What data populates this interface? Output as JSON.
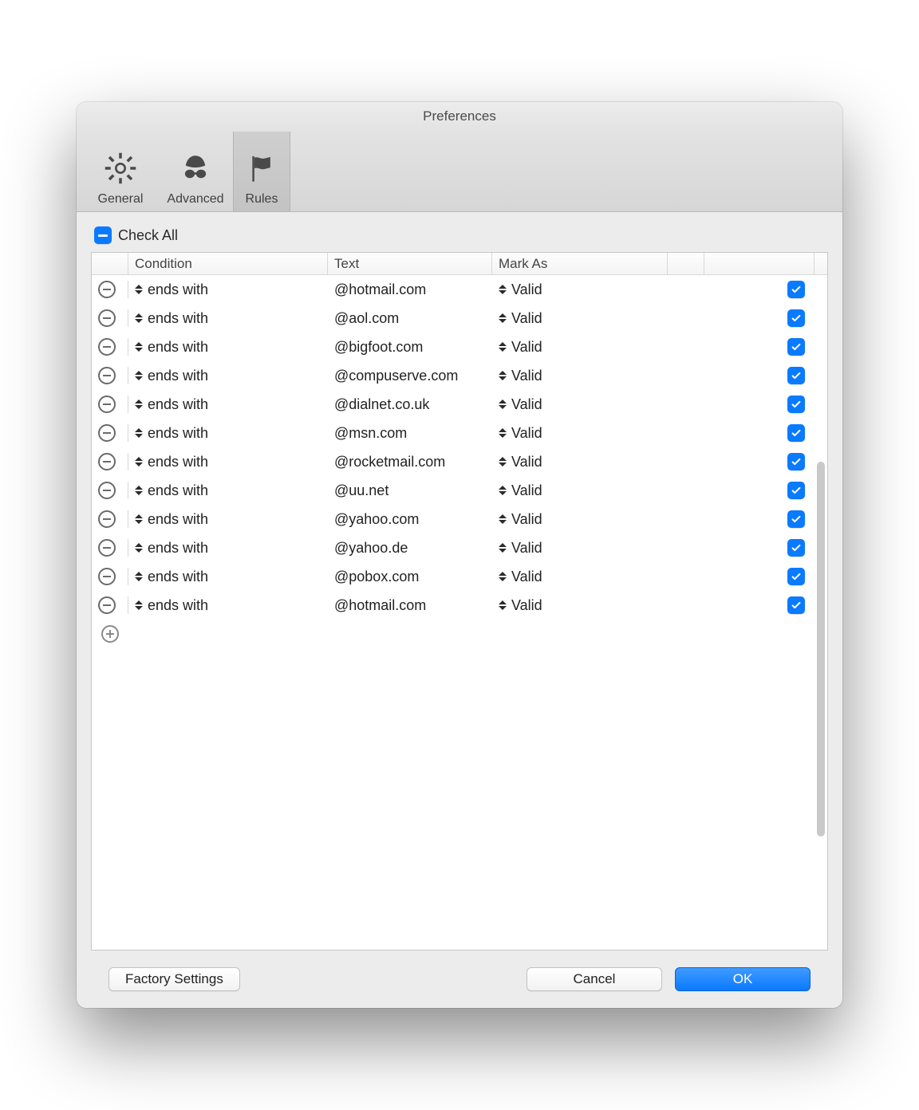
{
  "window": {
    "title": "Preferences"
  },
  "toolbar": {
    "general": {
      "label": "General"
    },
    "advanced": {
      "label": "Advanced"
    },
    "rules": {
      "label": "Rules"
    },
    "selected": "rules"
  },
  "checkAll": {
    "label": "Check All",
    "state": "indeterminate"
  },
  "columns": {
    "condition": "Condition",
    "text": "Text",
    "mark": "Mark As"
  },
  "rows": [
    {
      "condition": "ends with",
      "text": "@hotmail.com",
      "mark": "Valid",
      "checked": true
    },
    {
      "condition": "ends with",
      "text": "@aol.com",
      "mark": "Valid",
      "checked": true
    },
    {
      "condition": "ends with",
      "text": "@bigfoot.com",
      "mark": "Valid",
      "checked": true
    },
    {
      "condition": "ends with",
      "text": "@compuserve.com",
      "mark": "Valid",
      "checked": true
    },
    {
      "condition": "ends with",
      "text": "@dialnet.co.uk",
      "mark": "Valid",
      "checked": true
    },
    {
      "condition": "ends with",
      "text": "@msn.com",
      "mark": "Valid",
      "checked": true
    },
    {
      "condition": "ends with",
      "text": "@rocketmail.com",
      "mark": "Valid",
      "checked": true
    },
    {
      "condition": "ends with",
      "text": "@uu.net",
      "mark": "Valid",
      "checked": true
    },
    {
      "condition": "ends with",
      "text": "@yahoo.com",
      "mark": "Valid",
      "checked": true
    },
    {
      "condition": "ends with",
      "text": "@yahoo.de",
      "mark": "Valid",
      "checked": true
    },
    {
      "condition": "ends with",
      "text": "@pobox.com",
      "mark": "Valid",
      "checked": true
    },
    {
      "condition": "ends with",
      "text": "@hotmail.com",
      "mark": "Valid",
      "checked": true
    }
  ],
  "buttons": {
    "factory": "Factory Settings",
    "cancel": "Cancel",
    "ok": "OK"
  }
}
